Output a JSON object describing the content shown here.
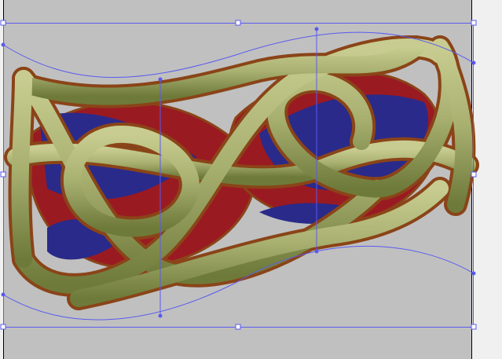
{
  "colors": {
    "canvas": "#c0c0c0",
    "outside": "#f0f0f0",
    "selection": "#5a5af0",
    "knot_fill": "#a8b070",
    "knot_outline": "#8a4418",
    "red": "#9a1a22",
    "blue": "#2a2a8a"
  },
  "design": {
    "name": "celtic-knot-embroidery"
  }
}
